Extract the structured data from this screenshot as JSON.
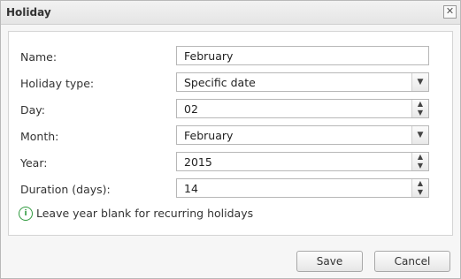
{
  "dialog": {
    "title": "Holiday",
    "close_glyph": "✕"
  },
  "form": {
    "name_label": "Name:",
    "name_value": "February",
    "holiday_type_label": "Holiday type:",
    "holiday_type_value": "Specific date",
    "day_label": "Day:",
    "day_value": "02",
    "month_label": "Month:",
    "month_value": "February",
    "year_label": "Year:",
    "year_value": "2015",
    "duration_label": "Duration (days):",
    "duration_value": "14"
  },
  "hint": {
    "text": "Leave year blank for recurring holidays",
    "icon": "info-icon",
    "icon_color": "#2f9a3e"
  },
  "buttons": {
    "save_label": "Save",
    "cancel_label": "Cancel"
  }
}
